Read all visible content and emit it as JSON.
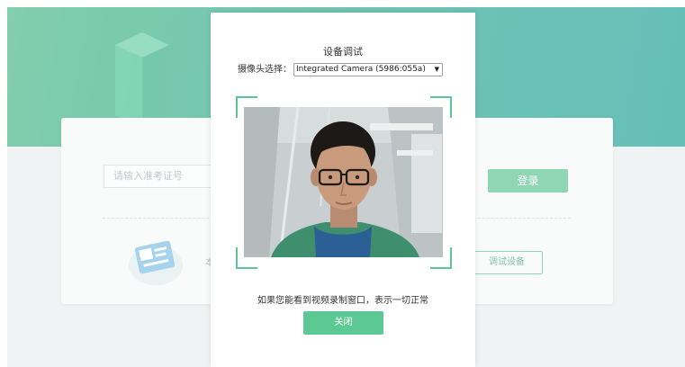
{
  "background": {
    "exam_id_placeholder": "请输入准考证号",
    "login_button": "登录",
    "partial_text": "本",
    "device_test_button": "调试设备",
    "colors": {
      "banner": "#3bb08f",
      "accent": "#5fc596"
    }
  },
  "modal": {
    "title": "设备调试",
    "camera_select": {
      "label": "摄像头选择：",
      "selected": "Integrated Camera (5986:055a)"
    },
    "status_text": "如果您能看到视频录制窗口，表示一切正常",
    "close_button": "关闭",
    "colors": {
      "frame": "#5fc596",
      "button": "#5cc893"
    }
  }
}
